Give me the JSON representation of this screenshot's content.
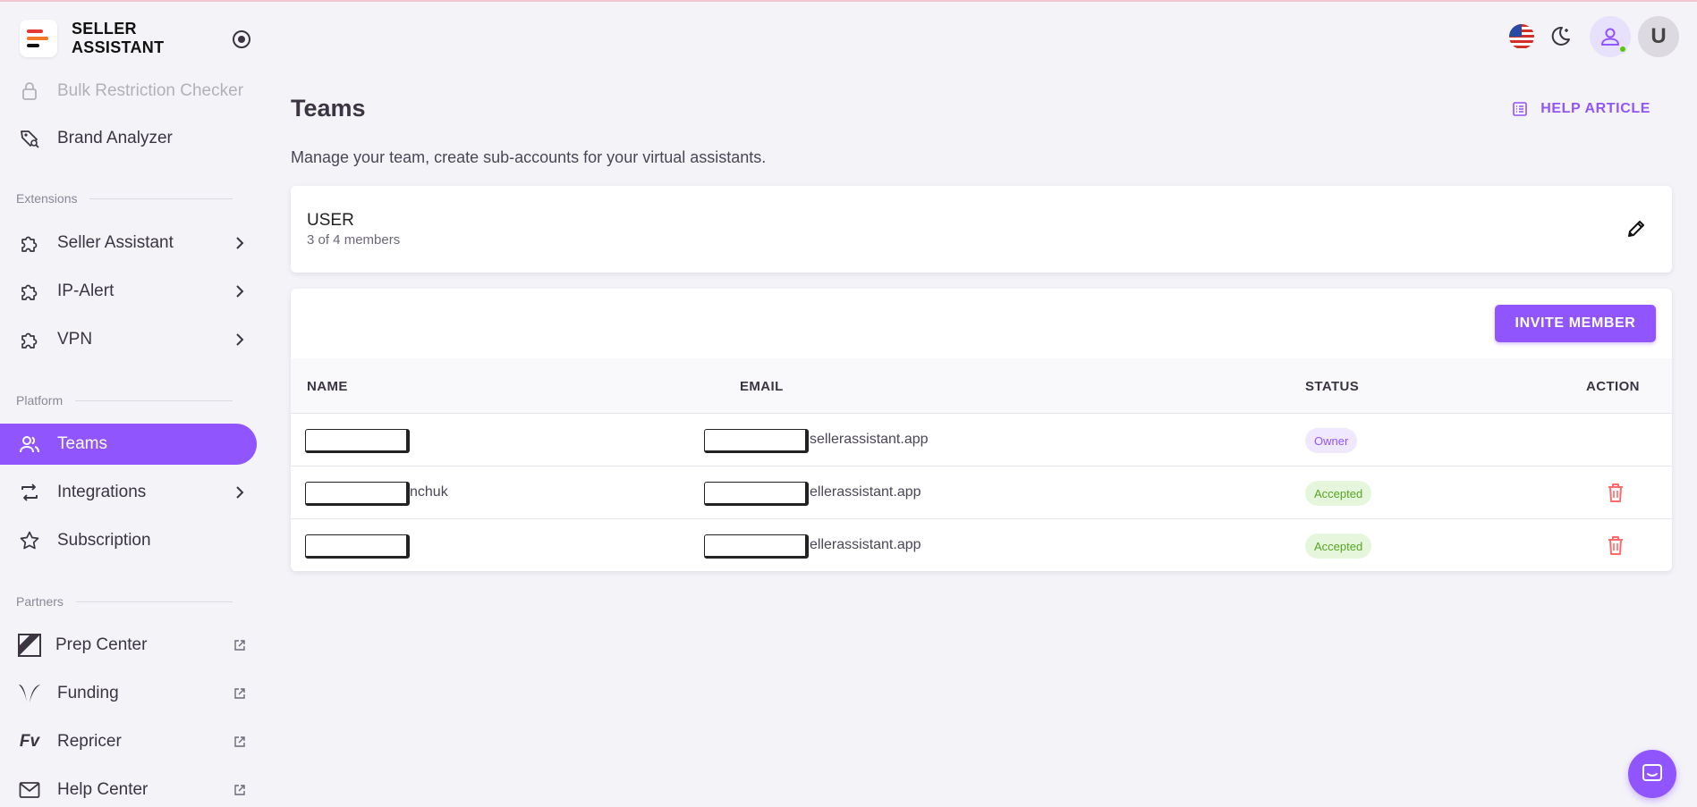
{
  "brand": {
    "line1": "SELLER",
    "line2": "ASSISTANT",
    "logo_colors": [
      "#e53935",
      "#f07a2a",
      "#111111"
    ]
  },
  "sidebar": {
    "top_items": [
      {
        "label": "Bulk Restriction Checker",
        "icon": "lock-icon"
      },
      {
        "label": "Brand Analyzer",
        "icon": "tag-search-icon"
      }
    ],
    "sections": {
      "extensions": "Extensions",
      "platform": "Platform",
      "partners": "Partners"
    },
    "extensions": [
      {
        "label": "Seller Assistant",
        "icon": "puzzle-icon"
      },
      {
        "label": "IP-Alert",
        "icon": "puzzle-icon"
      },
      {
        "label": "VPN",
        "icon": "puzzle-icon"
      }
    ],
    "platform": [
      {
        "label": "Teams",
        "icon": "people-icon",
        "active": true
      },
      {
        "label": "Integrations",
        "icon": "swap-icon"
      },
      {
        "label": "Subscription",
        "icon": "star-icon"
      }
    ],
    "partners": [
      {
        "label": "Prep Center",
        "icon": "prep-center-logo-icon"
      },
      {
        "label": "Funding",
        "icon": "funding-logo-icon"
      },
      {
        "label": "Repricer",
        "icon": "repricer-logo-icon",
        "logo_text": "Fv"
      },
      {
        "label": "Help Center",
        "icon": "mail-icon"
      }
    ]
  },
  "header": {
    "avatar_letter": "U",
    "accent": "#9155fd"
  },
  "main": {
    "title": "Teams",
    "help_article": "HELP ARTICLE",
    "description": "Manage your team, create sub-accounts for your virtual assistants.",
    "team": {
      "name": "USER",
      "members": "3 of 4 members"
    },
    "invite_button": "INVITE MEMBER",
    "columns": [
      "NAME",
      "EMAIL",
      "STATUS",
      "ACTION"
    ],
    "rows": [
      {
        "name": "",
        "email": "sellerassistant.app",
        "status": "Owner"
      },
      {
        "name": "nchuk",
        "email": "ellerassistant.app",
        "status": "Accepted"
      },
      {
        "name": "",
        "email": "ellerassistant.app",
        "status": "Accepted"
      }
    ]
  }
}
